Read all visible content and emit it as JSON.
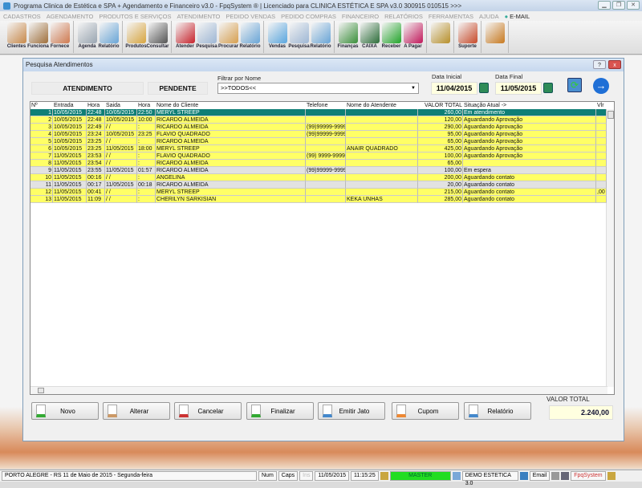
{
  "window": {
    "title": "Programa Clinica de Estética e SPA + Agendamento e Financeiro v3.0 - FpqSystem ® | Licenciado para  CLINICA ESTÉTICA E SPA v3.0 300915 010515 >>>"
  },
  "menu": [
    "CADASTROS",
    "AGENDAMENTO",
    "PRODUTOS E SERVIÇOS",
    "ATENDIMENTO",
    "PEDIDO VENDAS",
    "PEDIDO COMPRAS",
    "FINANCEIRO",
    "RELATÓRIOS",
    "FERRAMENTAS",
    "AJUDA"
  ],
  "menu_email": "E-MAIL",
  "toolbar": [
    [
      {
        "label": "Clientes",
        "color": "#c98a4b"
      },
      {
        "label": "Funciona",
        "color": "#a0703c"
      },
      {
        "label": "Fornece",
        "color": "#d07a50"
      }
    ],
    [
      {
        "label": "Agenda",
        "color": "#9aa6b2"
      },
      {
        "label": "Relatório",
        "color": "#6aa6d8"
      }
    ],
    [
      {
        "label": "Produtos",
        "color": "#d9a640"
      },
      {
        "label": "Consultar",
        "color": "#555555"
      }
    ],
    [
      {
        "label": "Atender",
        "color": "#c8232c"
      },
      {
        "label": "Pesquisa",
        "color": "#9fb8d6"
      },
      {
        "label": "Procurar",
        "color": "#d8a050"
      },
      {
        "label": "Relatório",
        "color": "#6aa6d8"
      }
    ],
    [
      {
        "label": "Vendas",
        "color": "#5aa7e0"
      },
      {
        "label": "Pesquisa",
        "color": "#9fb8d6"
      },
      {
        "label": "Relatório",
        "color": "#6aa6d8"
      }
    ],
    [
      {
        "label": "Finanças",
        "color": "#3a8f3a"
      },
      {
        "label": "CAIXA",
        "color": "#2d6e3a"
      },
      {
        "label": "Receber",
        "color": "#22a52a"
      },
      {
        "label": "A Pagar",
        "color": "#c2185b"
      }
    ],
    [
      {
        "label": "",
        "color": "#b8902a"
      }
    ],
    [
      {
        "label": "Suporte",
        "color": "#c94a2a"
      }
    ],
    [
      {
        "label": "",
        "color": "#c97a20"
      }
    ]
  ],
  "dialog": {
    "title": "Pesquisa Atendimentos",
    "help": "?",
    "close": "x",
    "status_label": "ATENDIMENTO",
    "status_value": "PENDENTE",
    "filter_label": "Filtrar por Nome",
    "filter_value": ">>TODOS<<",
    "date_start_label": "Data Inicial",
    "date_start": "11/04/2015",
    "date_end_label": "Data Final",
    "date_end": "11/05/2015",
    "columns": [
      "Nº",
      "Entrada",
      "Hora",
      "Saida",
      "Hora",
      "Nome do Cliente",
      "Telefone",
      "Nome do Atendente",
      "VALOR TOTAL",
      "Situação Atual ->",
      "Vlr"
    ],
    "rows": [
      [
        "1",
        "10/05/2015",
        "22:48",
        "10/05/2015",
        "22:50",
        "MERYL STREEP",
        "",
        "",
        "260,00",
        "Em atendimento",
        ""
      ],
      [
        "2",
        "10/05/2015",
        "22:48",
        "10/05/2015",
        "10:00",
        "RICARDO ALMEIDA",
        "",
        "",
        "120,00",
        "Aguardando Aprovação",
        ""
      ],
      [
        "3",
        "10/05/2015",
        "22:49",
        " / /",
        ":",
        "RICARDO ALMEIDA",
        "(99)99999-9999",
        "",
        "290,00",
        "Aguardando Aprovação",
        ""
      ],
      [
        "4",
        "10/05/2015",
        "23:24",
        "10/05/2015",
        "23:25",
        "FLAVIO QUADRADO",
        "(99)99999-9999",
        "",
        "95,00",
        "Aguardando Aprovação",
        ""
      ],
      [
        "5",
        "10/05/2015",
        "23:25",
        " / /",
        ":",
        "RICARDO ALMEIDA",
        "",
        "",
        "65,00",
        "Aguardando Aprovação",
        ""
      ],
      [
        "6",
        "10/05/2015",
        "23:25",
        "11/05/2015",
        "18:00",
        "MERYL STREEP",
        "",
        "ANAIR QUADRADO",
        "425,00",
        "Aguardando Aprovação",
        ""
      ],
      [
        "7",
        "11/05/2015",
        "23:53",
        " / /",
        ":",
        "FLAVIO QUADRADO",
        "(99) 9999-9999",
        "",
        "100,00",
        "Aguardando Aprovação",
        ""
      ],
      [
        "8",
        "11/05/2015",
        "23:54",
        " / /",
        ":",
        "RICARDO ALMEIDA",
        "",
        "",
        "65,00",
        "",
        ""
      ],
      [
        "9",
        "11/05/2015",
        "23:55",
        "11/05/2015",
        "01:57",
        "RICARDO ALMEIDA",
        "(99)99999-9999",
        "",
        "100,00",
        "Em espera",
        ""
      ],
      [
        "10",
        "11/05/2015",
        "00:16",
        " / /",
        ":",
        "ANGELINA",
        "",
        "",
        "200,00",
        "Aguardando contato",
        ""
      ],
      [
        "11",
        "11/05/2015",
        "00:17",
        "11/05/2015",
        "00:18",
        "RICARDO ALMEIDA",
        "",
        "",
        "20,00",
        "Aguardando contato",
        ""
      ],
      [
        "12",
        "11/05/2015",
        "00:41",
        " / /",
        ":",
        "MERYL STREEP",
        "",
        "",
        "215,00",
        "Aguardando contato",
        ",00"
      ],
      [
        "13",
        "11/05/2015",
        "11:09",
        " / /",
        ":",
        "CHERILYN SARKISIAN",
        "",
        "KEKA UNHAS",
        "285,00",
        "Aguardando contato",
        ""
      ]
    ],
    "row_styles": [
      "selected",
      "yellow",
      "yellow",
      "yellow",
      "yellow",
      "yellow",
      "yellow",
      "yellow",
      "gray",
      "yellow",
      "gray",
      "yellow",
      "yellow"
    ],
    "buttons": [
      "Novo",
      "Alterar",
      "Cancelar",
      "Finalizar",
      "Emitir Jato",
      "Cupom",
      "Relatório"
    ],
    "total_label": "VALOR TOTAL",
    "total_value": "2.240,00"
  },
  "colors": {
    "selected": "#0f7f76",
    "yellow": "#ffff66",
    "gray": "#e2e2e2"
  },
  "statusbar": {
    "location": "PORTO ALEGRE - RS 11 de Maio de 2015 - Segunda-feira",
    "num": "Num",
    "caps": "Caps",
    "ins": "Ins",
    "date": "11/05/2015",
    "time": "11:15:25",
    "user": "MASTER",
    "company": "DEMO ESTETICA 3.0",
    "email": "Email",
    "brand": "FpqSystem"
  }
}
